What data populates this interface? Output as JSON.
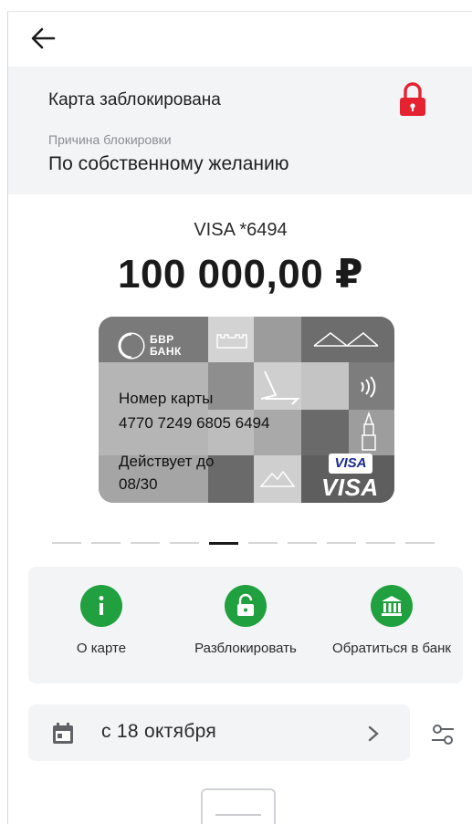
{
  "header": {
    "back_icon": "arrow-left-icon"
  },
  "status": {
    "title": "Карта заблокирована",
    "lock_icon": "lock-red-icon",
    "reason_label": "Причина блокировки",
    "reason_value": "По собственному желанию",
    "accent": "#e52330"
  },
  "card": {
    "name": "VISA *6494",
    "balance": "100 000,00 ₽",
    "bank_line1": "БВР",
    "bank_line2": "БАНК",
    "number_label": "Номер карты",
    "number": "4770 7249 6805 6494",
    "valid_label": "Действует до",
    "valid_value": "08/30",
    "visa_small": "VISA",
    "visa_big": "VISA"
  },
  "pager": {
    "count": 10,
    "active_index": 4
  },
  "actions": [
    {
      "label": "О карте",
      "icon": "info-icon"
    },
    {
      "label": "Разблокировать",
      "icon": "unlock-icon"
    },
    {
      "label": "Обратиться в банк",
      "icon": "bank-icon"
    }
  ],
  "actions_color": "#20a03e",
  "period": {
    "label": "с 18 октября",
    "calendar_icon": "calendar-icon",
    "chevron_icon": "chevron-right-icon",
    "filter_icon": "filter-sliders-icon"
  }
}
